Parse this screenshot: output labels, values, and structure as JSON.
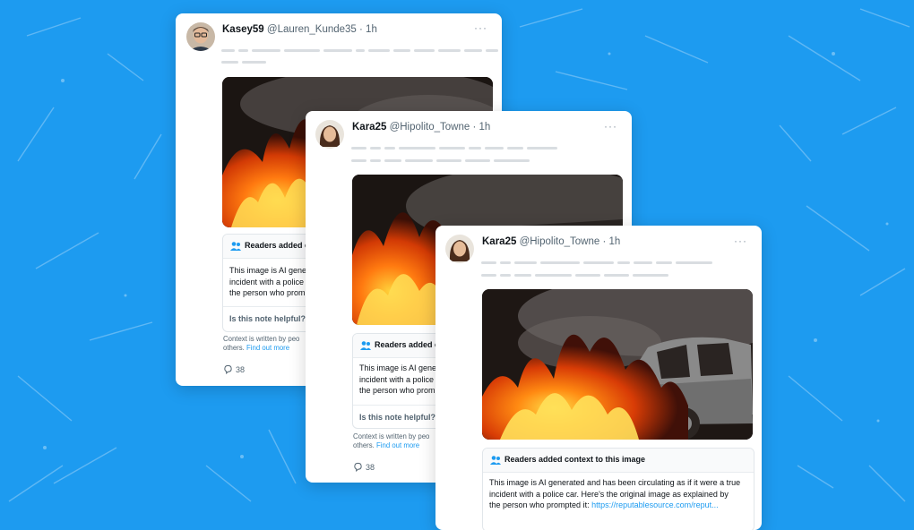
{
  "colors": {
    "background": "#1d9bf0",
    "link": "#1d9bf0",
    "text_primary": "#0f1419",
    "text_secondary": "#536471"
  },
  "tweets": [
    {
      "display_name": "Kasey59",
      "handle": "@Lauren_Kunde35",
      "time": "· 1h",
      "avatar": "avatar-man-glasses",
      "more": "···",
      "note_title": "Readers added co",
      "note_lines": [
        "This image is AI gener",
        "incident with a police",
        "the person who promp"
      ],
      "helpful": "Is this note helpful?",
      "footer_line1": "Context is written by peo",
      "footer_prefix": "others.",
      "footer_link": "Find out more",
      "reply_count": "38"
    },
    {
      "display_name": "Kara25",
      "handle": "@Hipolito_Towne",
      "time": "· 1h",
      "avatar": "avatar-woman",
      "more": "···",
      "note_title": "Readers added co",
      "note_lines": [
        "This image is AI gener",
        "incident with a police",
        "the person who prom"
      ],
      "helpful": "Is this note helpful?",
      "footer_line1": "Context is written by peo",
      "footer_prefix": "others.",
      "footer_link": "Find out more",
      "reply_count": "38"
    },
    {
      "display_name": "Kara25",
      "handle": "@Hipolito_Towne",
      "time": "· 1h",
      "avatar": "avatar-woman",
      "more": "···",
      "note_title": "Readers added context to this image",
      "note_lines": [
        "This image is AI generated and has been circulating as if it were a true",
        "incident with a police car. Here's the original image as explained by",
        "the person who prompted it: "
      ],
      "note_link": "https://reputablesource.com/reput..."
    }
  ]
}
